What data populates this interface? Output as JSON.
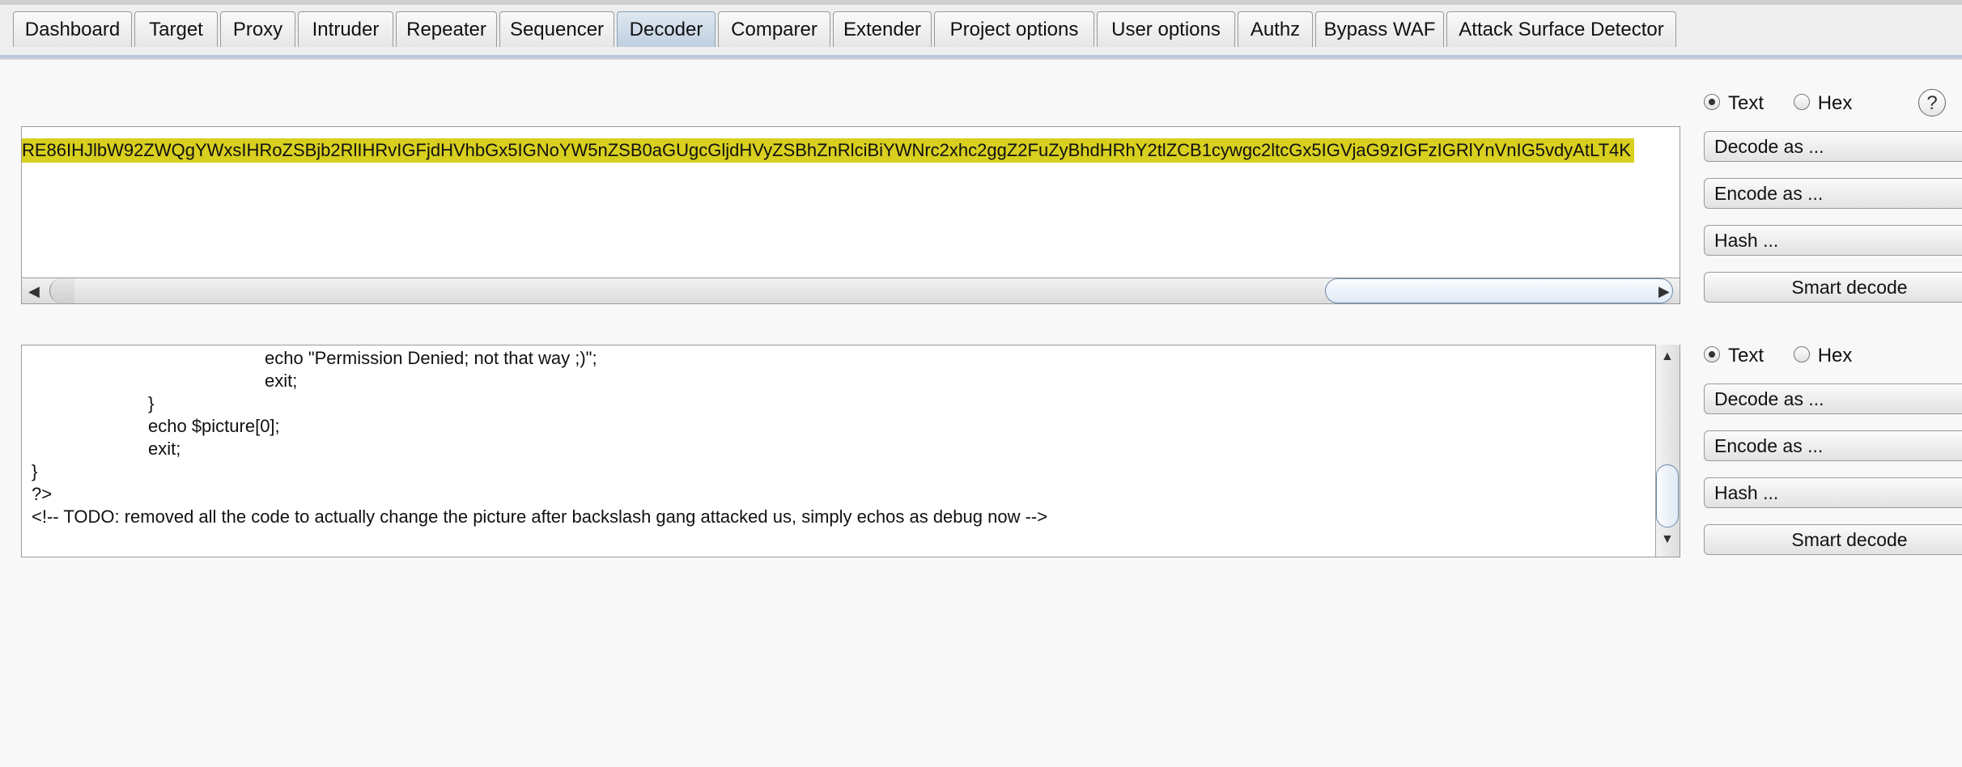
{
  "tabs": [
    {
      "label": "Dashboard",
      "active": false
    },
    {
      "label": "Target",
      "active": false
    },
    {
      "label": "Proxy",
      "active": false
    },
    {
      "label": "Intruder",
      "active": false
    },
    {
      "label": "Repeater",
      "active": false
    },
    {
      "label": "Sequencer",
      "active": false
    },
    {
      "label": "Decoder",
      "active": true
    },
    {
      "label": "Comparer",
      "active": false
    },
    {
      "label": "Extender",
      "active": false
    },
    {
      "label": "Project options",
      "active": false
    },
    {
      "label": "User options",
      "active": false
    },
    {
      "label": "Authz",
      "active": false
    },
    {
      "label": "Bypass WAF",
      "active": false
    },
    {
      "label": "Attack Surface Detector",
      "active": false
    }
  ],
  "input_panel": {
    "text": "RE86IHJlbW92ZWQgYWxsIHRoZSBjb2RlIHRvIGFjdHVhbGx5IGNoYW5nZSB0aGUgcGljdHVyZSBhZnRlciBiYWNrc2xhc2ggZ2FuZyBhdHRhY2tlZCB1cywgc2ltcGx5IGVjaG9zIGFzIGRlYnVnIG5vdyAtLT4K",
    "mode_text": "Text",
    "mode_hex": "Hex",
    "selected_mode": "Text",
    "help": "?",
    "decode_label": "Decode as ...",
    "encode_label": "Encode as ...",
    "hash_label": "Hash ...",
    "smart_label": "Smart decode"
  },
  "output_panel": {
    "lines": [
      "echo \"Permission Denied; not that way ;)\";",
      "exit;",
      "}",
      "echo $picture[0];",
      "exit;",
      "}",
      "?>",
      "<!-- TODO: removed all the code to actually change the picture after backslash gang attacked us, simply echos as debug now -->"
    ],
    "mode_text": "Text",
    "mode_hex": "Hex",
    "selected_mode": "Text",
    "decode_label": "Decode as ...",
    "encode_label": "Encode as ...",
    "hash_label": "Hash ...",
    "smart_label": "Smart decode"
  }
}
